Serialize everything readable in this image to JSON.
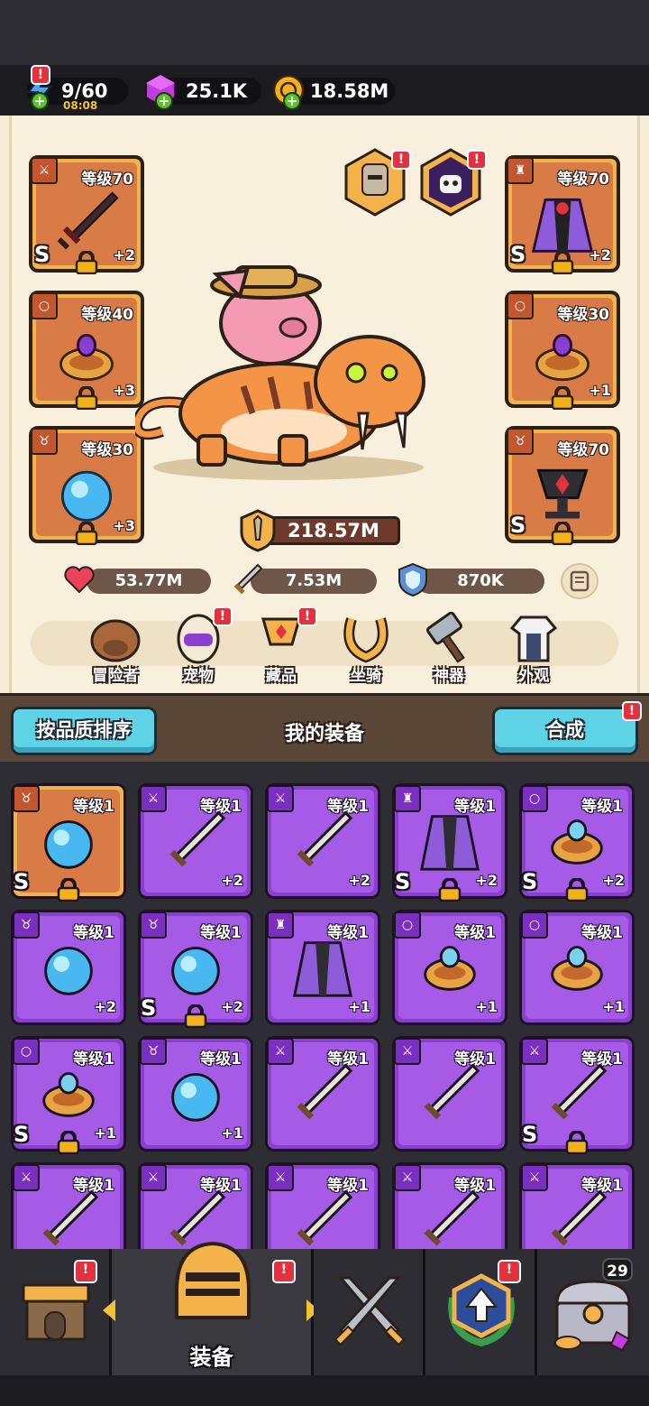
{
  "resources": {
    "energy": "9/60",
    "energy_timer": "08:08",
    "gems": "25.1K",
    "coins": "18.58M"
  },
  "equipment": {
    "left_slots": [
      {
        "type_icon": "sword-icon",
        "level": "等级70",
        "rank": "S",
        "bonus": "+2"
      },
      {
        "type_icon": "ring-icon",
        "level": "等级40",
        "rank": "",
        "bonus": "+3"
      },
      {
        "type_icon": "necklace-icon",
        "level": "等级30",
        "rank": "",
        "bonus": "+3"
      }
    ],
    "right_slots": [
      {
        "type_icon": "armor-icon",
        "level": "等级70",
        "rank": "S",
        "bonus": "+2"
      },
      {
        "type_icon": "ring-icon",
        "level": "等级30",
        "rank": "",
        "bonus": "+1"
      },
      {
        "type_icon": "necklace-icon",
        "level": "等级70",
        "rank": "S",
        "bonus": ""
      }
    ]
  },
  "power": "218.57M",
  "stats": {
    "hp": "53.77M",
    "attack": "7.53M",
    "defense": "870K"
  },
  "categories": [
    "冒险者",
    "宠物",
    "藏品",
    "坐骑",
    "神器",
    "外观"
  ],
  "list_header": {
    "sort_button": "按品质排序",
    "title": "我的装备",
    "merge_button": "合成"
  },
  "items": [
    {
      "type": "necklace",
      "level": "等级1",
      "rank": "S",
      "bonus": "",
      "gold": true,
      "locked": true
    },
    {
      "type": "sword",
      "level": "等级1",
      "rank": "",
      "bonus": "+2",
      "gold": false,
      "locked": false
    },
    {
      "type": "sword",
      "level": "等级1",
      "rank": "",
      "bonus": "+2",
      "gold": false,
      "locked": false
    },
    {
      "type": "armor",
      "level": "等级1",
      "rank": "S",
      "bonus": "+2",
      "gold": false,
      "locked": true
    },
    {
      "type": "ring",
      "level": "等级1",
      "rank": "S",
      "bonus": "+2",
      "gold": false,
      "locked": true
    },
    {
      "type": "necklace",
      "level": "等级1",
      "rank": "",
      "bonus": "+2",
      "gold": false,
      "locked": false
    },
    {
      "type": "necklace",
      "level": "等级1",
      "rank": "S",
      "bonus": "+2",
      "gold": false,
      "locked": true
    },
    {
      "type": "armor",
      "level": "等级1",
      "rank": "",
      "bonus": "+1",
      "gold": false,
      "locked": false
    },
    {
      "type": "ring",
      "level": "等级1",
      "rank": "",
      "bonus": "+1",
      "gold": false,
      "locked": false
    },
    {
      "type": "ring",
      "level": "等级1",
      "rank": "",
      "bonus": "+1",
      "gold": false,
      "locked": false
    },
    {
      "type": "ring",
      "level": "等级1",
      "rank": "S",
      "bonus": "+1",
      "gold": false,
      "locked": true
    },
    {
      "type": "necklace",
      "level": "等级1",
      "rank": "",
      "bonus": "+1",
      "gold": false,
      "locked": false
    },
    {
      "type": "sword",
      "level": "等级1",
      "rank": "",
      "bonus": "",
      "gold": false,
      "locked": false
    },
    {
      "type": "sword",
      "level": "等级1",
      "rank": "",
      "bonus": "",
      "gold": false,
      "locked": false
    },
    {
      "type": "sword",
      "level": "等级1",
      "rank": "S",
      "bonus": "",
      "gold": false,
      "locked": true
    },
    {
      "type": "sword",
      "level": "等级1",
      "rank": "",
      "bonus": "",
      "gold": false,
      "locked": false
    },
    {
      "type": "sword",
      "level": "等级1",
      "rank": "",
      "bonus": "",
      "gold": false,
      "locked": false
    },
    {
      "type": "sword",
      "level": "等级1",
      "rank": "",
      "bonus": "",
      "gold": false,
      "locked": false
    },
    {
      "type": "sword",
      "level": "等级1",
      "rank": "",
      "bonus": "",
      "gold": false,
      "locked": false
    },
    {
      "type": "sword",
      "level": "等级1",
      "rank": "",
      "bonus": "",
      "gold": false,
      "locked": false
    }
  ],
  "bottom_nav": {
    "active_label": "装备",
    "chest_count": "29",
    "tabs": [
      "shop-icon",
      "helmet-icon",
      "crossed-swords-icon",
      "upgrade-icon",
      "treasure-chest-icon"
    ]
  },
  "colors": {
    "epic_purple": "#a65be6",
    "legendary_gold": "#f3b24a",
    "accent_cyan": "#5ed3e6",
    "alert_red": "#e3323f"
  }
}
